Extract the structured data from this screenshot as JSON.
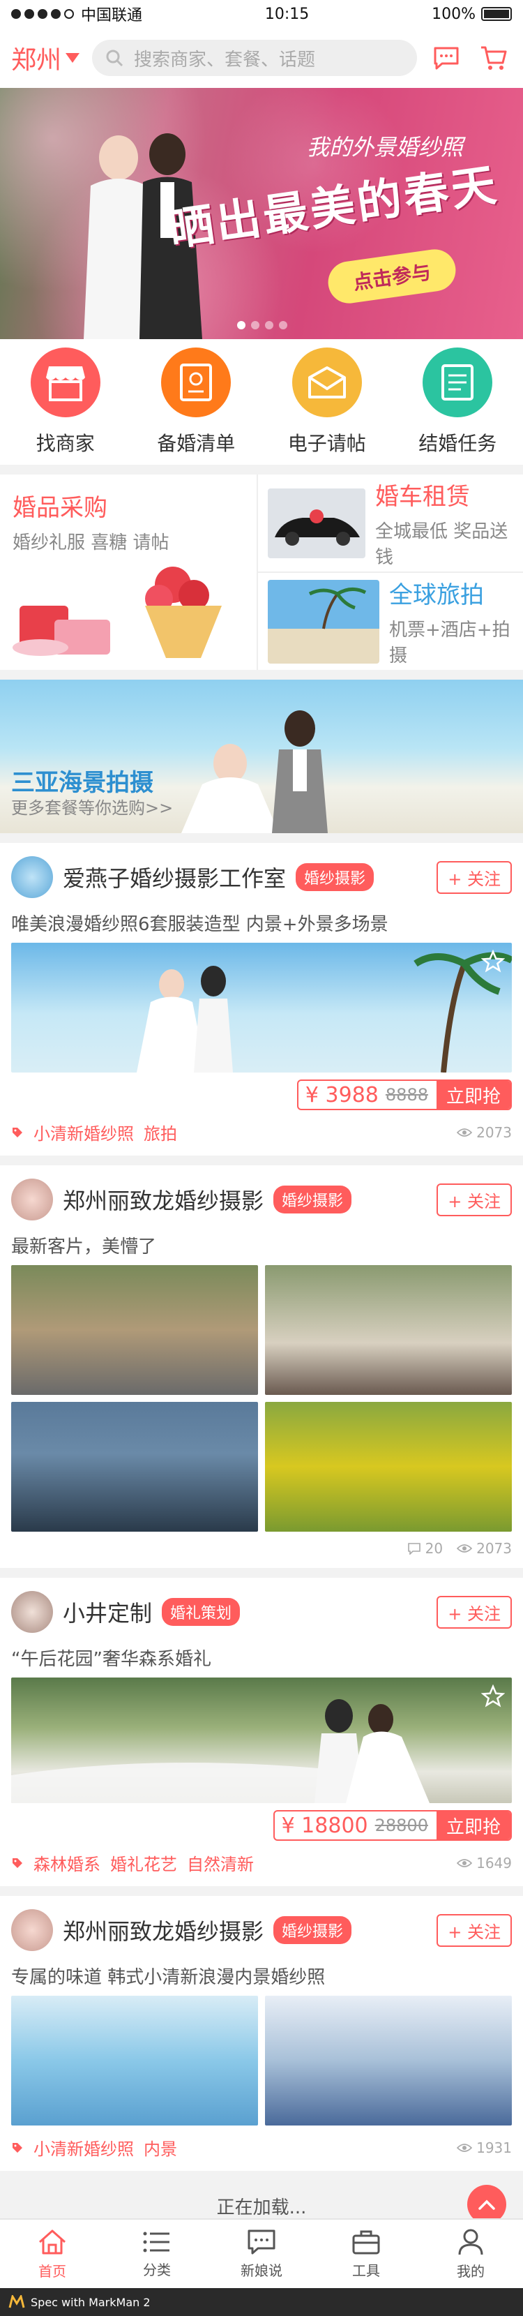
{
  "status": {
    "carrier": "中国联通",
    "time": "10:15",
    "battery": "100%"
  },
  "header": {
    "city": "郑州",
    "search_placeholder": "搜索商家、套餐、话题"
  },
  "banner": {
    "line1": "我的外景婚纱照",
    "line2": "晒出最美的春天",
    "cta": "点击参与"
  },
  "nav": [
    {
      "label": "找商家",
      "color": "#ff5c5c"
    },
    {
      "label": "备婚清单",
      "color": "#ff7a1a"
    },
    {
      "label": "电子请帖",
      "color": "#f6b83a"
    },
    {
      "label": "结婚任务",
      "color": "#2bc4a0"
    }
  ],
  "categories": {
    "left": {
      "title": "婚品采购",
      "sub": "婚纱礼服 喜糖 请帖"
    },
    "right1": {
      "title": "婚车租赁",
      "sub": "全城最低 奖品送钱"
    },
    "right2": {
      "title": "全球旅拍",
      "sub": "机票+酒店+拍摄"
    }
  },
  "sanya": {
    "title": "三亚海景拍摄",
    "sub": "更多套餐等你选购>>"
  },
  "cards": [
    {
      "shop": "爱燕子婚纱摄影工作室",
      "tag": "婚纱摄影",
      "follow": "+ 关注",
      "desc": "唯美浪漫婚纱照6套服装造型 内景+外景多场景",
      "price_now": "¥ 3988",
      "price_old": "8888",
      "buy": "立即抢",
      "tags": [
        "小清新婚纱照",
        "旅拍"
      ],
      "views": "2073"
    },
    {
      "shop": "郑州丽致龙婚纱摄影",
      "tag": "婚纱摄影",
      "follow": "+ 关注",
      "desc": "最新客片，美懵了",
      "comments": "20",
      "views": "2073"
    },
    {
      "shop": "小井定制",
      "tag": "婚礼策划",
      "follow": "+ 关注",
      "desc": "“午后花园”奢华森系婚礼",
      "price_now": "¥ 18800",
      "price_old": "28800",
      "buy": "立即抢",
      "tags": [
        "森林婚系",
        "婚礼花艺",
        "自然清新"
      ],
      "views": "1649"
    },
    {
      "shop": "郑州丽致龙婚纱摄影",
      "tag": "婚纱摄影",
      "follow": "+ 关注",
      "desc": "专属的味道 韩式小清新浪漫内景婚纱照",
      "tags": [
        "小清新婚纱照",
        "内景"
      ],
      "views": "1931"
    }
  ],
  "loading": "正在加载...",
  "tabs": [
    {
      "label": "首页",
      "icon": "home-icon"
    },
    {
      "label": "分类",
      "icon": "list-icon"
    },
    {
      "label": "新娘说",
      "icon": "chat-icon"
    },
    {
      "label": "工具",
      "icon": "toolbox-icon"
    },
    {
      "label": "我的",
      "icon": "user-icon"
    }
  ],
  "footer": "Spec with MarkMan 2",
  "colors": {
    "accent": "#ff5c5c"
  }
}
